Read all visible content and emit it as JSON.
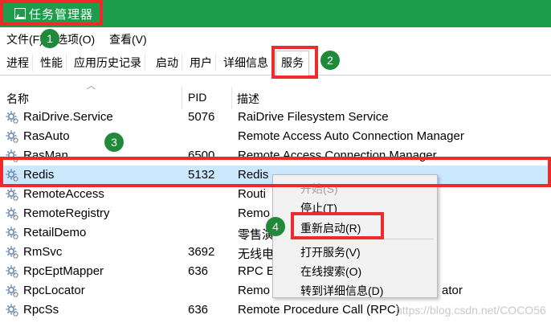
{
  "window": {
    "title": "任务管理器",
    "accent": "#1d9d4c"
  },
  "menubar": {
    "file": "文件(F)",
    "options": "选项(O)",
    "view": "查看(V)"
  },
  "tabs": [
    "进程",
    "性能",
    "应用历史记录",
    "启动",
    "用户",
    "详细信息",
    "服务"
  ],
  "active_tab": "服务",
  "columns": {
    "name": "名称",
    "pid": "PID",
    "desc": "描述"
  },
  "rows": [
    {
      "name": "RaiDrive.Service",
      "pid": "5076",
      "desc": "RaiDrive Filesystem Service"
    },
    {
      "name": "RasAuto",
      "pid": "",
      "desc": "Remote Access Auto Connection Manager"
    },
    {
      "name": "RasMan",
      "pid": "6500",
      "desc": "Remote Access Connection Manager"
    },
    {
      "name": "Redis",
      "pid": "5132",
      "desc": "Redis"
    },
    {
      "name": "RemoteAccess",
      "pid": "",
      "desc": "Routi"
    },
    {
      "name": "RemoteRegistry",
      "pid": "",
      "desc": "Remo"
    },
    {
      "name": "RetailDemo",
      "pid": "",
      "desc": "零售演"
    },
    {
      "name": "RmSvc",
      "pid": "3692",
      "desc": "无线电"
    },
    {
      "name": "RpcEptMapper",
      "pid": "636",
      "desc": "RPC E"
    },
    {
      "name": "RpcLocator",
      "pid": "",
      "desc": "Remo",
      "desc_tail": "ator"
    },
    {
      "name": "RpcSs",
      "pid": "636",
      "desc": "Remote Procedure Call (RPC)"
    }
  ],
  "context_menu": {
    "start": "开始(S)",
    "stop": "停止(T)",
    "restart": "重新启动(R)",
    "open_services": "打开服务(V)",
    "search_online": "在线搜索(O)",
    "goto_details": "转到详细信息(D)"
  },
  "badges": [
    "1",
    "2",
    "3",
    "4"
  ],
  "highlight_color": "#ee2b2b",
  "selected_row_color": "#cce8ff",
  "watermark": "https://blog.csdn.net/COCO56"
}
